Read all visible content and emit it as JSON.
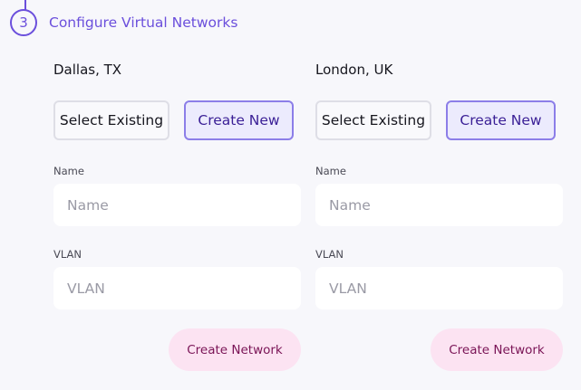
{
  "step": {
    "number": "3",
    "title": "Configure Virtual Networks"
  },
  "colors": {
    "accent": "#6b4fdc",
    "create_new_bg": "#ecebfd",
    "create_network_bg": "#fce3f2",
    "create_network_text": "#7a1456"
  },
  "locations": [
    {
      "name": "Dallas, TX",
      "select_existing_label": "Select Existing",
      "create_new_label": "Create New",
      "selected_mode": "Create New",
      "name_label": "Name",
      "name_value": "",
      "name_placeholder": "Name",
      "vlan_label": "VLAN",
      "vlan_value": "",
      "vlan_placeholder": "VLAN",
      "create_network_label": "Create Network"
    },
    {
      "name": "London, UK",
      "select_existing_label": "Select Existing",
      "create_new_label": "Create New",
      "selected_mode": "Create New",
      "name_label": "Name",
      "name_value": "",
      "name_placeholder": "Name",
      "vlan_label": "VLAN",
      "vlan_value": "",
      "vlan_placeholder": "VLAN",
      "create_network_label": "Create Network"
    }
  ]
}
